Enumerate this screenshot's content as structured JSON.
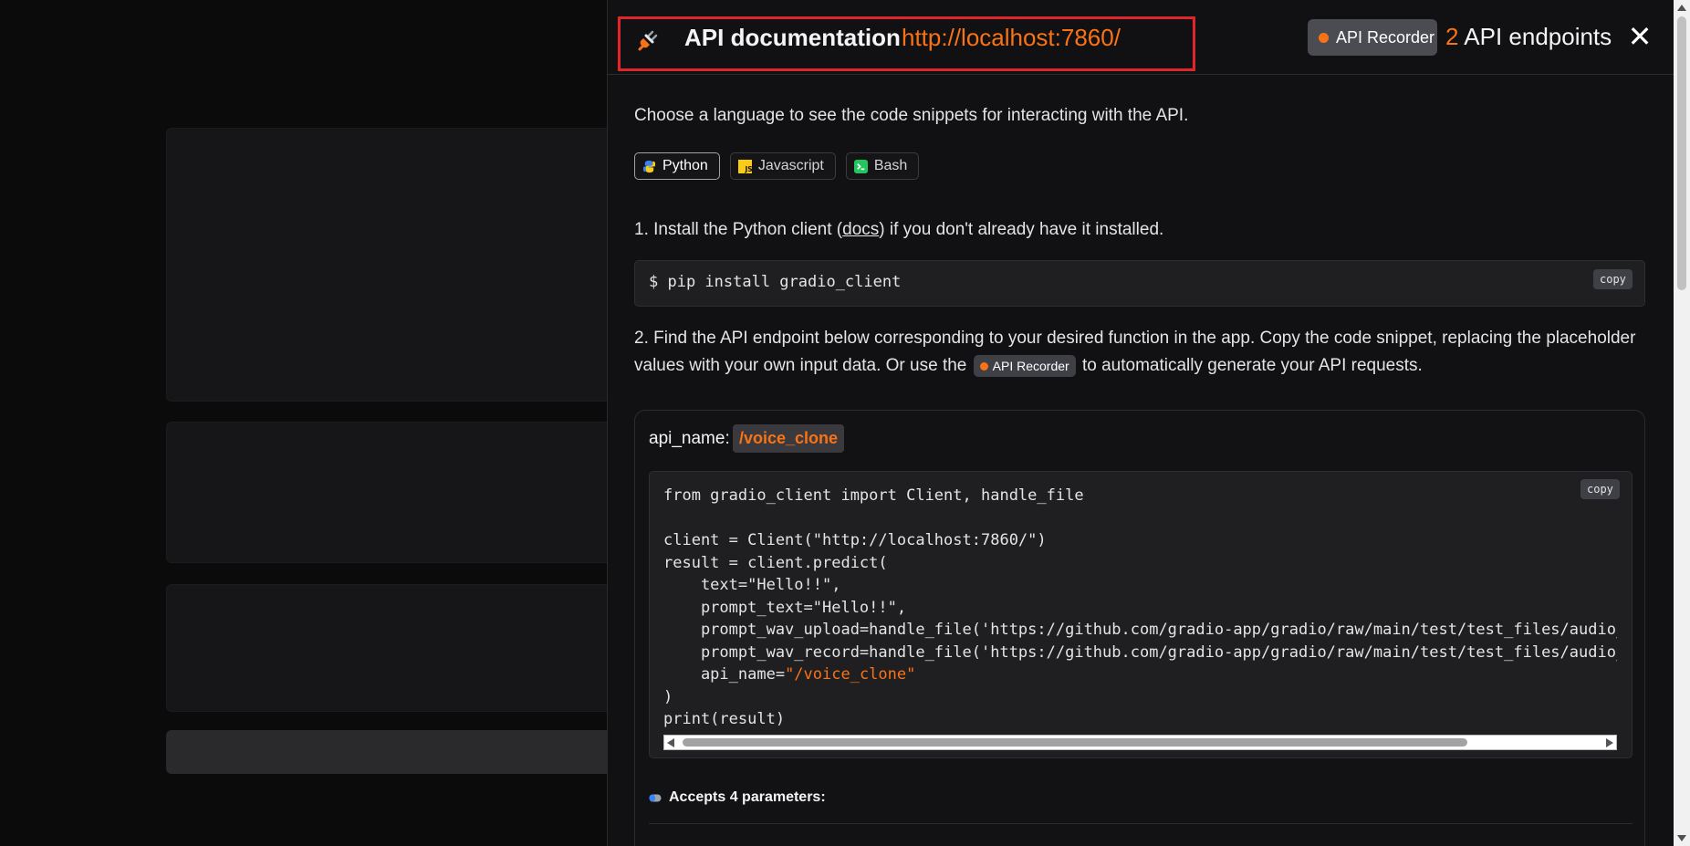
{
  "panel": {
    "title": "API documentation",
    "url": "http://localhost:7860/",
    "recorder_label": "API Recorder",
    "endpoint_count": "2",
    "endpoint_label": "API endpoints",
    "close_symbol": "✕"
  },
  "intro": {
    "choose_language": "Choose a language to see the code snippets for interacting with the API."
  },
  "languages": [
    {
      "label": "Python",
      "icon": "python-icon",
      "active": true
    },
    {
      "label": "Javascript",
      "icon": "javascript-icon",
      "active": false
    },
    {
      "label": "Bash",
      "icon": "bash-icon",
      "active": false
    }
  ],
  "step1": {
    "prefix": "1. Install the Python client (",
    "link": "docs",
    "suffix": ") if you don't already have it installed.",
    "command": "$ pip install gradio_client",
    "copy_label": "copy"
  },
  "step2": {
    "line1": "2. Find the API endpoint below corresponding to your desired function in the app. Copy the code snippet, replacing the placeholder",
    "line2_prefix": "values with your own input data. Or use the",
    "badge": "API Recorder",
    "line2_suffix": "to automatically generate your API requests."
  },
  "endpoint": {
    "api_name_label": "api_name:",
    "api_name": "/voice_clone",
    "copy_label": "copy",
    "code_lines": [
      "from gradio_client import Client, handle_file",
      "",
      "client = Client(\"http://localhost:7860/\")",
      "result = client.predict(",
      "    text=\"Hello!!\",",
      "    prompt_text=\"Hello!!\",",
      "    prompt_wav_upload=handle_file('https://github.com/gradio-app/gradio/raw/main/test/test_files/audio_sample.wav'),",
      "    prompt_wav_record=handle_file('https://github.com/gradio-app/gradio/raw/main/test/test_files/audio_sample.wav'),",
      "    api_name=",
      ")",
      "print(result)"
    ],
    "api_name_string": "\"/voice_clone\"",
    "params_label": "Accepts 4 parameters:"
  },
  "colors": {
    "accent": "#f97316",
    "highlight_frame": "#e0262a"
  }
}
